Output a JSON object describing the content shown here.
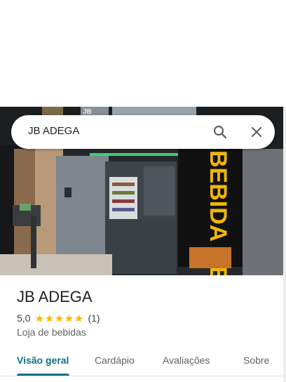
{
  "search": {
    "query": "JB ADEGA"
  },
  "place": {
    "name": "JB ADEGA",
    "rating": "5,0",
    "stars": 5,
    "review_count": "(1)",
    "category": "Loja de bebidas"
  },
  "tabs": [
    {
      "label": "Visão geral",
      "active": true
    },
    {
      "label": "Cardápio",
      "active": false
    },
    {
      "label": "Avaliações",
      "active": false
    },
    {
      "label": "Sobre",
      "active": false
    }
  ],
  "photo": {
    "banner_text": "BEBIDA GE",
    "sign_text": "JB"
  },
  "colors": {
    "accent": "#0b7285",
    "star": "#fbbc04",
    "banner": "#f2b705"
  },
  "icons": [
    "search-icon",
    "close-icon",
    "star-icon"
  ]
}
